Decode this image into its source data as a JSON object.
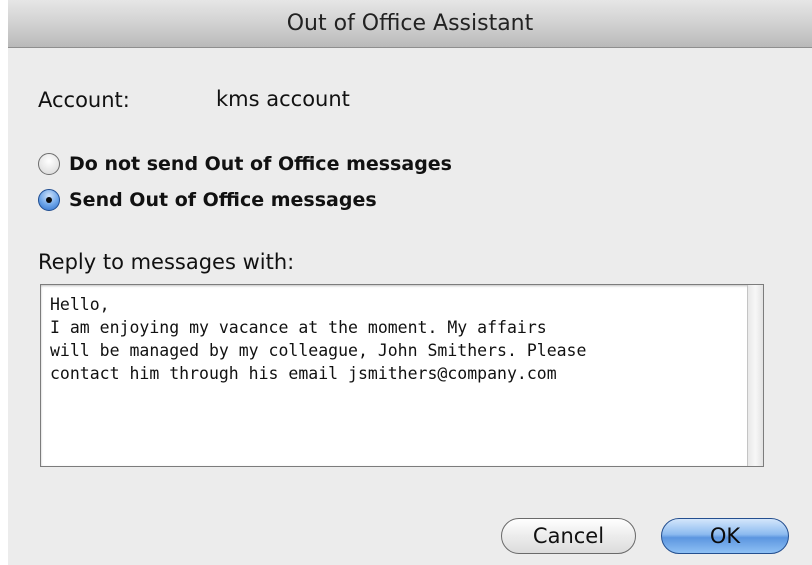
{
  "window": {
    "title": "Out of Office Assistant"
  },
  "account": {
    "label": "Account:",
    "value": "kms account"
  },
  "options": [
    {
      "label": "Do not send Out of Office messages",
      "selected": false
    },
    {
      "label": "Send Out of Office messages",
      "selected": true
    }
  ],
  "reply": {
    "label": "Reply to messages with:",
    "text": "Hello,\nI am enjoying my vacance at the moment. My affairs\nwill be managed by my colleague, John Smithers. Please\ncontact him through his email jsmithers@company.com"
  },
  "buttons": {
    "cancel": "Cancel",
    "ok": "OK"
  },
  "colors": {
    "default_button": "#5c96e0",
    "selected_radio": "#2e6ec9"
  }
}
